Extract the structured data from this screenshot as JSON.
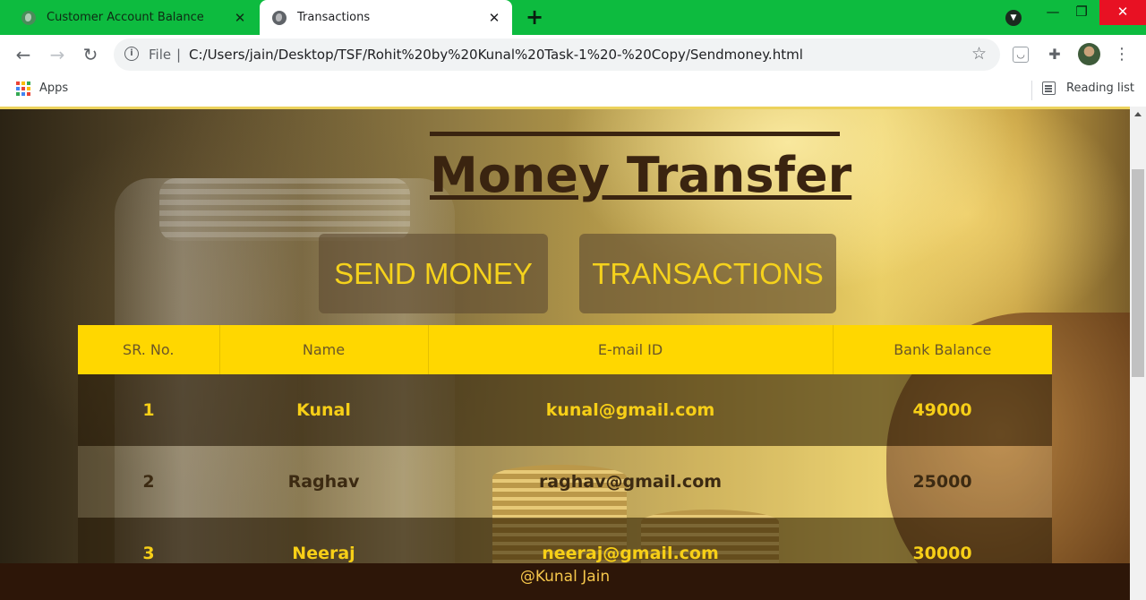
{
  "browser": {
    "tabs": [
      {
        "title": "Customer Account Balance",
        "active": false
      },
      {
        "title": "Transactions",
        "active": true
      }
    ],
    "new_tab": "+",
    "address": {
      "scheme": "File",
      "separator": "|",
      "url": "C:/Users/jain/Desktop/TSF/Rohit%20by%20Kunal%20Task-1%20-%20Copy/Sendmoney.html"
    },
    "bookmarks": {
      "apps_label": "Apps",
      "reading_list_label": "Reading list"
    },
    "accent_color": "#0dbb3f"
  },
  "page": {
    "title": "Money Transfer",
    "nav": {
      "send_money": "SEND MONEY",
      "transactions": "TRANSACTIONS"
    },
    "table": {
      "headers": [
        "SR. No.",
        "Name",
        "E-mail ID",
        "Bank Balance"
      ],
      "rows": [
        {
          "sr": "1",
          "name": "Kunal",
          "email": "kunal@gmail.com",
          "balance": "49000"
        },
        {
          "sr": "2",
          "name": "Raghav",
          "email": "raghav@gmail.com",
          "balance": "25000"
        },
        {
          "sr": "3",
          "name": "Neeraj",
          "email": "neeraj@gmail.com",
          "balance": "30000"
        }
      ]
    },
    "footer": "@Kunal Jain",
    "colors": {
      "header_bg": "#ffd700",
      "button_text": "#f5d21c",
      "title": "#3a2410",
      "footer_bg": "#2d1608"
    }
  }
}
